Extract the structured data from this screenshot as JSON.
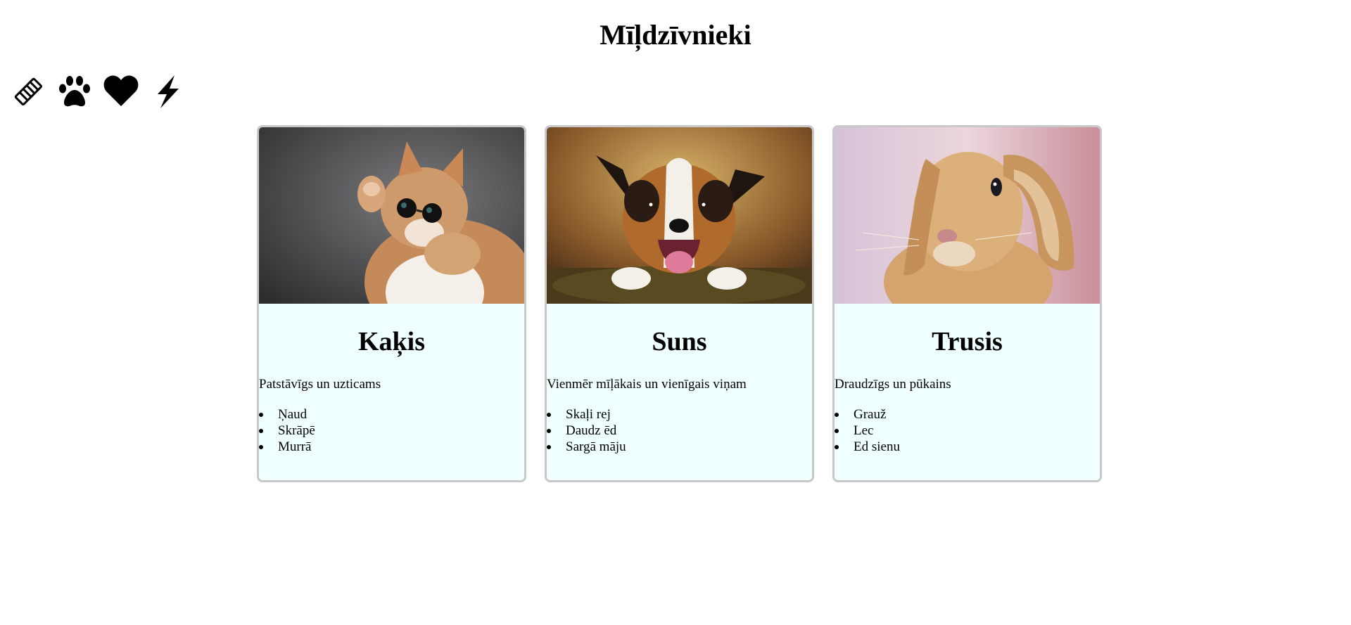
{
  "page": {
    "title": "Mīļdzīvnieki"
  },
  "icons": [
    {
      "name": "handshake-icon"
    },
    {
      "name": "paw-icon"
    },
    {
      "name": "heart-icon"
    },
    {
      "name": "lightning-icon"
    }
  ],
  "cards": [
    {
      "title": "Kaķis",
      "description": "Patstāvīgs un uzticams",
      "image": "cat-photo",
      "traits": [
        "Ņaud",
        "Skrāpē",
        "Murrā"
      ]
    },
    {
      "title": "Suns",
      "description": "Vienmēr mīļākais un vienīgais viņam",
      "image": "dog-photo",
      "traits": [
        "Skaļi rej",
        "Daudz ēd",
        "Sargā māju"
      ]
    },
    {
      "title": "Trusis",
      "description": "Draudzīgs un pūkains",
      "image": "rabbit-photo",
      "traits": [
        "Grauž",
        "Lec",
        "Ed sienu"
      ]
    }
  ],
  "colors": {
    "card_background": "#f0ffff",
    "card_border": "#c8c8c8",
    "text": "#000000"
  }
}
